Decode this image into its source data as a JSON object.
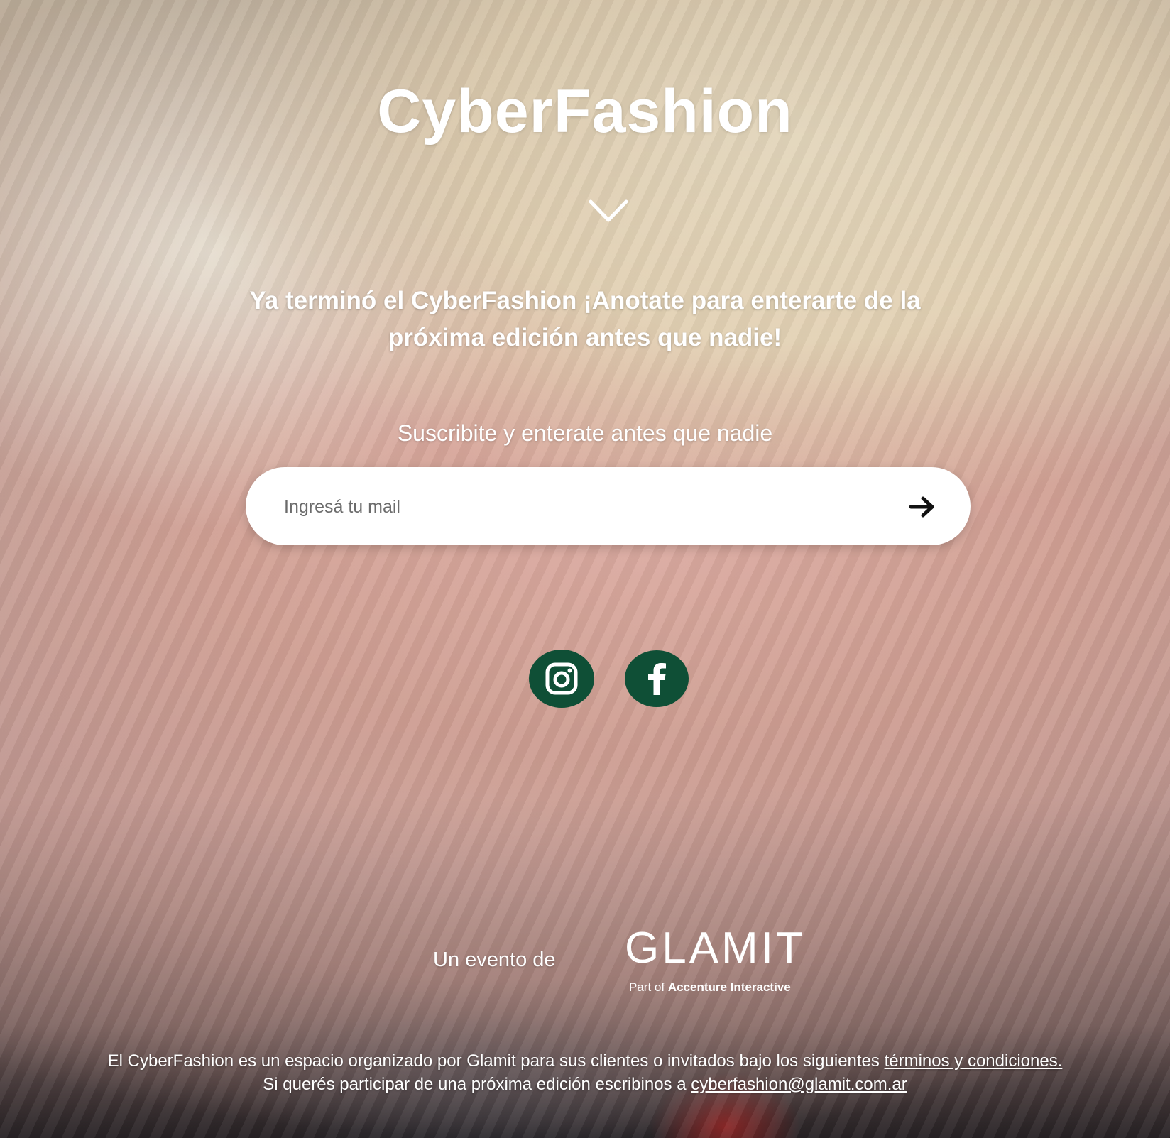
{
  "brand": {
    "title": "CyberFashion"
  },
  "hero": {
    "headline_line1": "Ya terminó el CyberFashion ¡Anotate para enterarte de la",
    "headline_line2": "próxima edición antes que nadie!",
    "scroll_icon": "chevron-down-icon"
  },
  "subscribe": {
    "label": "Suscribite y enterate antes que nadie",
    "email_placeholder": "Ingresá tu mail",
    "email_value": "",
    "submit_icon": "arrow-right-icon"
  },
  "social": [
    {
      "name": "instagram",
      "icon": "instagram-icon",
      "color": "#0f4f36"
    },
    {
      "name": "facebook",
      "icon": "facebook-icon",
      "color": "#0f4f36"
    }
  ],
  "organizer": {
    "label": "Un evento de",
    "logo_text": "GLAMIT",
    "logo_sub_prefix": "Part of ",
    "logo_sub_bold": "Accenture Interactive"
  },
  "footer": {
    "line1_text": "El CyberFashion es un espacio organizado por Glamit para sus clientes o invitados bajo los siguientes ",
    "terms_link": "términos y condiciones.",
    "line2_text": "Si querés participar de una próxima edición escribinos a ",
    "email_link": "cyberfashion@glamit.com.ar"
  }
}
